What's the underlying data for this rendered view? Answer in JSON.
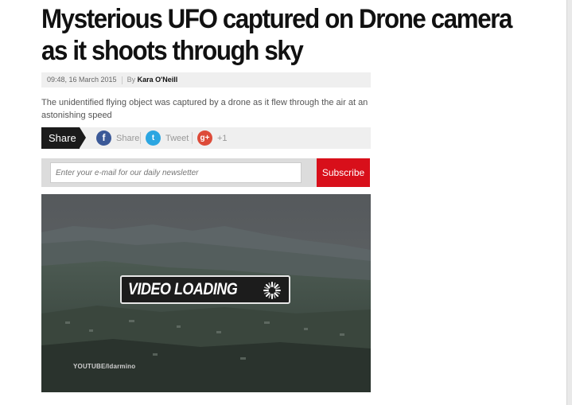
{
  "article": {
    "headline": "Mysterious UFO captured on Drone camera as it shoots through sky",
    "timestamp": "09:48, 16 March 2015",
    "by_label": "By",
    "author": "Kara O'Neill",
    "standfirst": "The unidentified flying object was captured by a drone as it flew through the air at an astonishing speed"
  },
  "share": {
    "tab_label": "Share",
    "facebook": {
      "icon": "f",
      "label": "Share",
      "color": "#3b5998"
    },
    "twitter": {
      "icon": "t",
      "label": "Tweet",
      "color": "#2ba6e1"
    },
    "googleplus": {
      "icon": "g+",
      "label": "+1",
      "color": "#dd4b39"
    }
  },
  "newsletter": {
    "placeholder": "Enter your e-mail for our daily newsletter",
    "button_label": "Subscribe",
    "button_color": "#d80f1a"
  },
  "video": {
    "loading_text": "VIDEO LOADING",
    "credit": "YOUTUBE/Idarmino"
  }
}
